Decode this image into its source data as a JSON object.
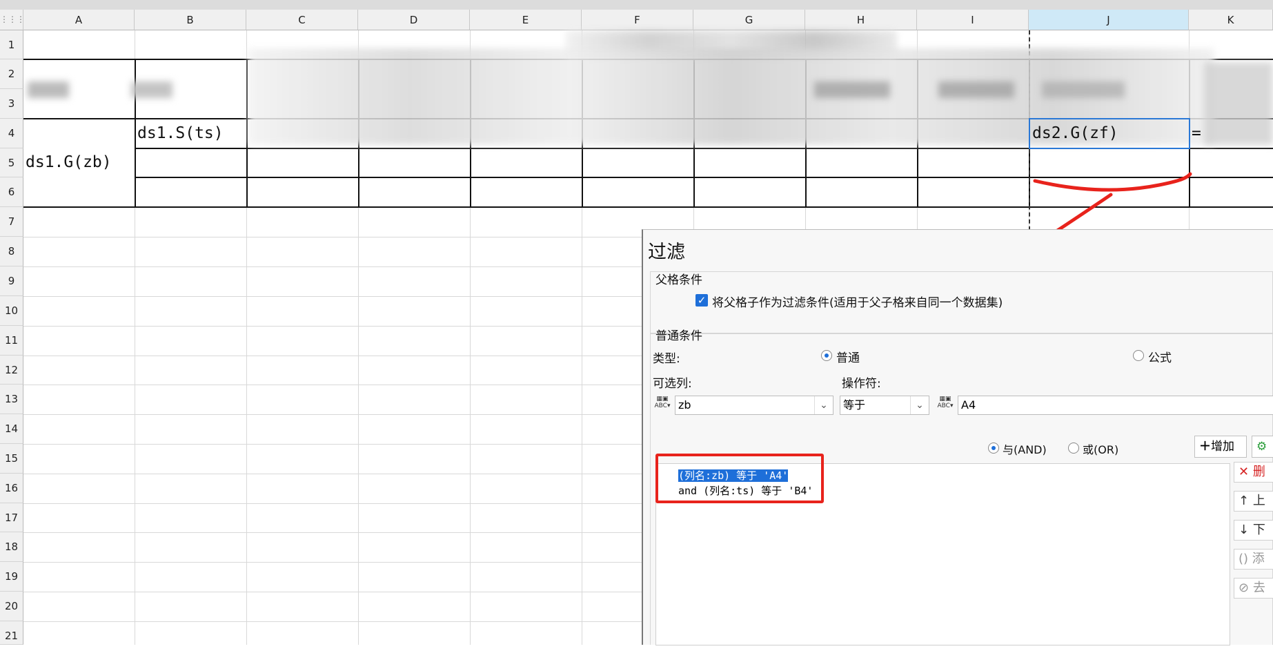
{
  "columns": [
    "A",
    "B",
    "C",
    "D",
    "E",
    "F",
    "G",
    "H",
    "I",
    "J",
    "K"
  ],
  "rows": [
    "1",
    "2",
    "3",
    "4",
    "5",
    "6",
    "7",
    "8",
    "9",
    "10",
    "11",
    "12",
    "13",
    "14",
    "15",
    "16",
    "17",
    "18",
    "19",
    "20",
    "21"
  ],
  "selected_column": "J",
  "cells": {
    "a5": "ds1.G(zb)",
    "b4": "ds1.S(ts)",
    "j4": "ds2.G(zf)",
    "k4": "="
  },
  "dialog": {
    "title": "过滤",
    "parent_group": "父格条件",
    "parent_checkbox": "将父格子作为过滤条件(适用于父子格来自同一个数据集)",
    "parent_checked": true,
    "normal_group": "普通条件",
    "type_label": "类型:",
    "type_normal": "普通",
    "type_formula": "公式",
    "type_selected": "普通",
    "column_label": "可选列:",
    "operator_label": "操作符:",
    "column_value": "zb",
    "operator_value": "等于",
    "value_text": "A4",
    "and_label": "与(AND)",
    "or_label": "或(OR)",
    "logic_selected": "与(AND)",
    "add_button": "增加",
    "conditions": [
      "(列名:zb) 等于 'A4'",
      "and (列名:ts) 等于 'B4'"
    ],
    "side_buttons": [
      "删",
      "上",
      "下",
      "添",
      "去"
    ]
  },
  "colors": {
    "accent": "#1e6fd9",
    "annotation": "#e8231c",
    "selection": "#2a78d6"
  }
}
